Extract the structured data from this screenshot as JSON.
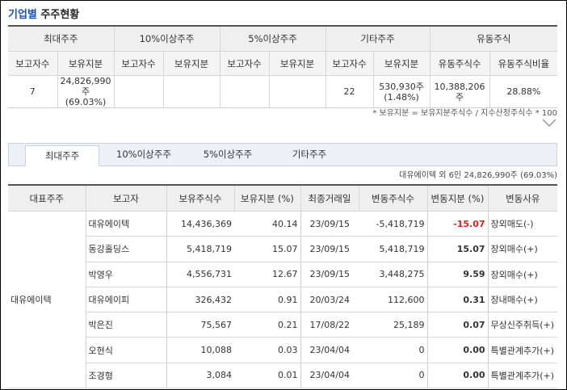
{
  "title": {
    "prefix": "기업별",
    "main": "주주현황"
  },
  "summary": {
    "groups": [
      "최대주주",
      "10%이상주주",
      "5%이상주주",
      "기타주주",
      "유동주식"
    ],
    "subheaders": [
      "보고자수",
      "보유지분",
      "보고자수",
      "보유지분",
      "보고자수",
      "보유지분",
      "보고자수",
      "보유지분",
      "유동주식수",
      "유동주식비율"
    ],
    "values": {
      "largest_count": "7",
      "largest_share": "24,826,990주",
      "largest_pct": "(69.03%)",
      "p10_count": "",
      "p10_share": "",
      "p5_count": "",
      "p5_share": "",
      "other_count": "22",
      "other_share": "530,930주",
      "other_pct": "(1.48%)",
      "float_shares": "10,388,206주",
      "float_ratio": "28.88%"
    },
    "note": "* 보유지분 = 보유지분주식수 / 지수산정주식수 * 100"
  },
  "tabs": [
    "최대주주",
    "10%이상주주",
    "5%이상주주",
    "기타주주"
  ],
  "tab_info": "대유에이텍 외 6인 24,826,990주 (69.03%)",
  "detail": {
    "headers": [
      "대표주주",
      "보고자",
      "보유주식수",
      "보유지분 (%)",
      "최종거래일",
      "변동주식수",
      "변동지분 (%)",
      "변동사유"
    ],
    "representative": "대유에이텍",
    "rows": [
      {
        "reporter": "대유에이텍",
        "shares": "14,436,369",
        "pct": "40.14",
        "date": "23/09/15",
        "change": "-5,418,719",
        "change_pct": "-15.07",
        "reason": "장외매도(-)"
      },
      {
        "reporter": "동강홀딩스",
        "shares": "5,418,719",
        "pct": "15.07",
        "date": "23/09/15",
        "change": "5,418,719",
        "change_pct": "15.07",
        "reason": "장외매수(+)"
      },
      {
        "reporter": "박영우",
        "shares": "4,556,731",
        "pct": "12.67",
        "date": "23/09/15",
        "change": "3,448,275",
        "change_pct": "9.59",
        "reason": "장외매수(+)"
      },
      {
        "reporter": "대유에이피",
        "shares": "326,432",
        "pct": "0.91",
        "date": "20/03/24",
        "change": "112,600",
        "change_pct": "0.31",
        "reason": "장내매수(+)"
      },
      {
        "reporter": "박은진",
        "shares": "75,567",
        "pct": "0.21",
        "date": "17/08/22",
        "change": "25,189",
        "change_pct": "0.07",
        "reason": "무상신주취득(+)"
      },
      {
        "reporter": "오현식",
        "shares": "10,088",
        "pct": "0.03",
        "date": "23/04/04",
        "change": "0",
        "change_pct": "0.00",
        "reason": "특별관계추가(+)"
      },
      {
        "reporter": "조경형",
        "shares": "3,084",
        "pct": "0.01",
        "date": "23/04/04",
        "change": "0",
        "change_pct": "0.00",
        "reason": "특별관계추가(+)"
      }
    ]
  }
}
